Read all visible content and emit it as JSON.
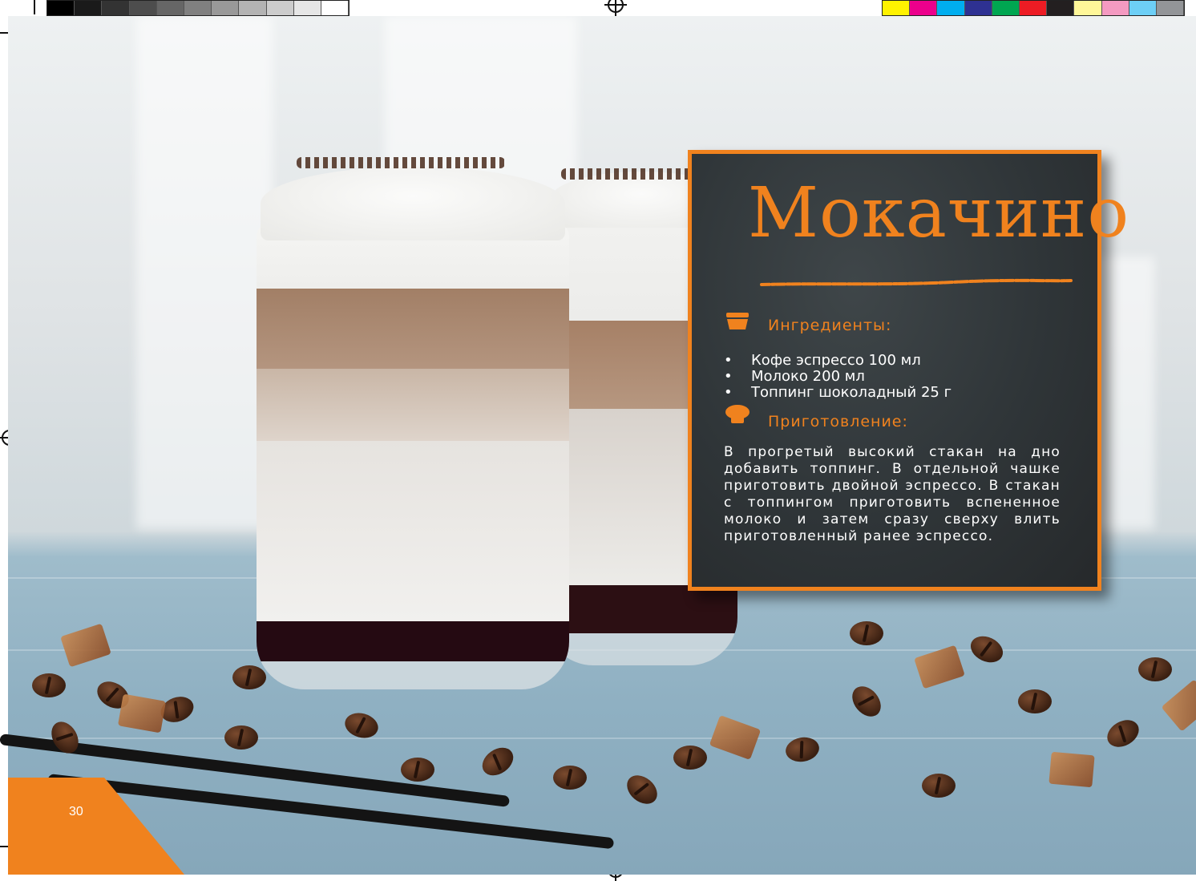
{
  "recipe": {
    "title": "Мокачино",
    "ingredients_heading": "Ингредиенты:",
    "ingredients": [
      "Кофе эспрессо 100 мл",
      "Молоко 200 мл",
      "Топпинг шоколадный 25 г"
    ],
    "preparation_heading": "Приготовление:",
    "instructions": "В прогретый высокий стакан на дно добавить топпинг. В отдельной чашке приготовить двойной эспрессо. В стакан с топпингом приготовить вспененное молоко и затем сразу сверху влить приготовленный ранее эспрессо."
  },
  "page": {
    "number": "30"
  },
  "icons": {
    "ingredients": "basket-icon",
    "preparation": "chef-hat-icon"
  },
  "colors": {
    "accent": "#f0821e",
    "chalkboard": "#2f3538",
    "text": "#ffffff"
  },
  "print_marks": {
    "grayscale": [
      "#000000",
      "#1a1a1a",
      "#333333",
      "#4d4d4d",
      "#666666",
      "#808080",
      "#999999",
      "#b3b3b3",
      "#cccccc",
      "#e6e6e6",
      "#ffffff"
    ],
    "colors": [
      "#fff200",
      "#ec008c",
      "#00aeef",
      "#2e3192",
      "#00a651",
      "#ed1c24",
      "#231f20",
      "#fff799",
      "#f49ac1",
      "#6dcff6",
      "#939598"
    ]
  }
}
